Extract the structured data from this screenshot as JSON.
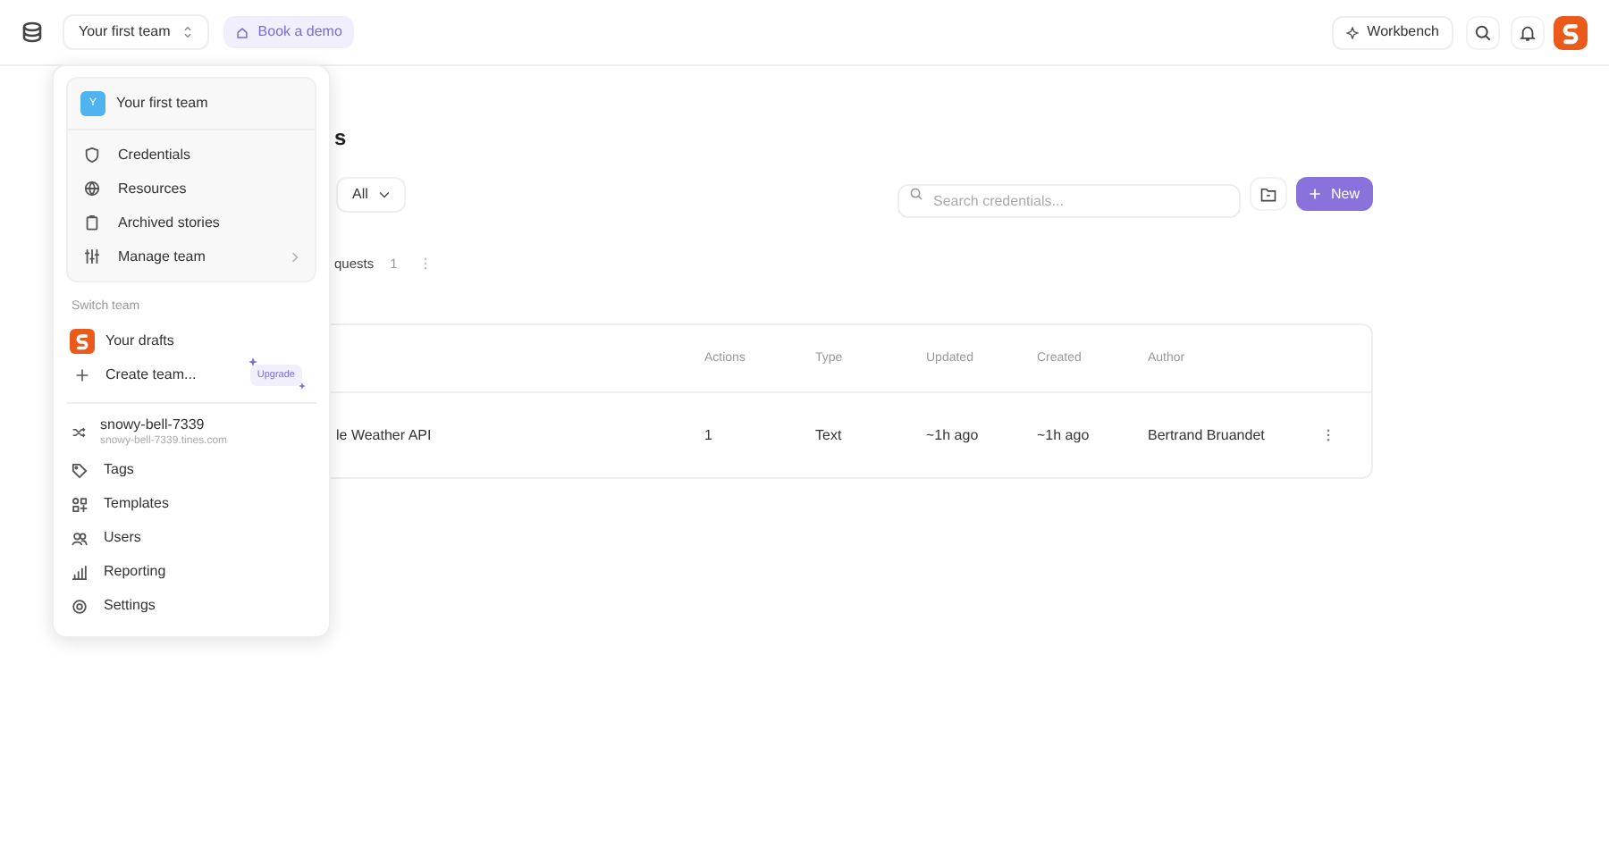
{
  "header": {
    "team_switcher": "Your first team",
    "book_demo": "Book a demo",
    "workbench": "Workbench"
  },
  "page": {
    "title": "s",
    "filter": "All",
    "search": {
      "placeholder": "Search credentials..."
    },
    "new_button": "New",
    "tabs": [
      {
        "label": "quests",
        "count": "1"
      }
    ],
    "table": {
      "columns": [
        "Actions",
        "Type",
        "Updated",
        "Created",
        "Author"
      ],
      "rows": [
        {
          "name": "le Weather API",
          "cells": [
            "1",
            "Text",
            "~1h ago",
            "~1h ago",
            "Bertrand Bruandet"
          ]
        }
      ]
    }
  },
  "menu": {
    "current_team": {
      "avatar": "Y",
      "name": "Your first team"
    },
    "team_items": [
      {
        "label": "Credentials",
        "submenu": false
      },
      {
        "label": "Resources",
        "submenu": false
      },
      {
        "label": "Archived stories",
        "submenu": false
      },
      {
        "label": "Manage team",
        "submenu": true
      }
    ],
    "switch_heading": "Switch team",
    "teams": [
      {
        "kind": "logo",
        "label": "Your drafts"
      },
      {
        "kind": "create",
        "label": "Create team...",
        "badge": "Upgrade"
      }
    ],
    "tenant": {
      "name": "snowy-bell-7339",
      "domain": "snowy-bell-7339.tines.com"
    },
    "items": [
      {
        "label": "Tags"
      },
      {
        "label": "Templates"
      },
      {
        "label": "Users"
      },
      {
        "label": "Reporting"
      },
      {
        "label": "Settings"
      }
    ]
  }
}
